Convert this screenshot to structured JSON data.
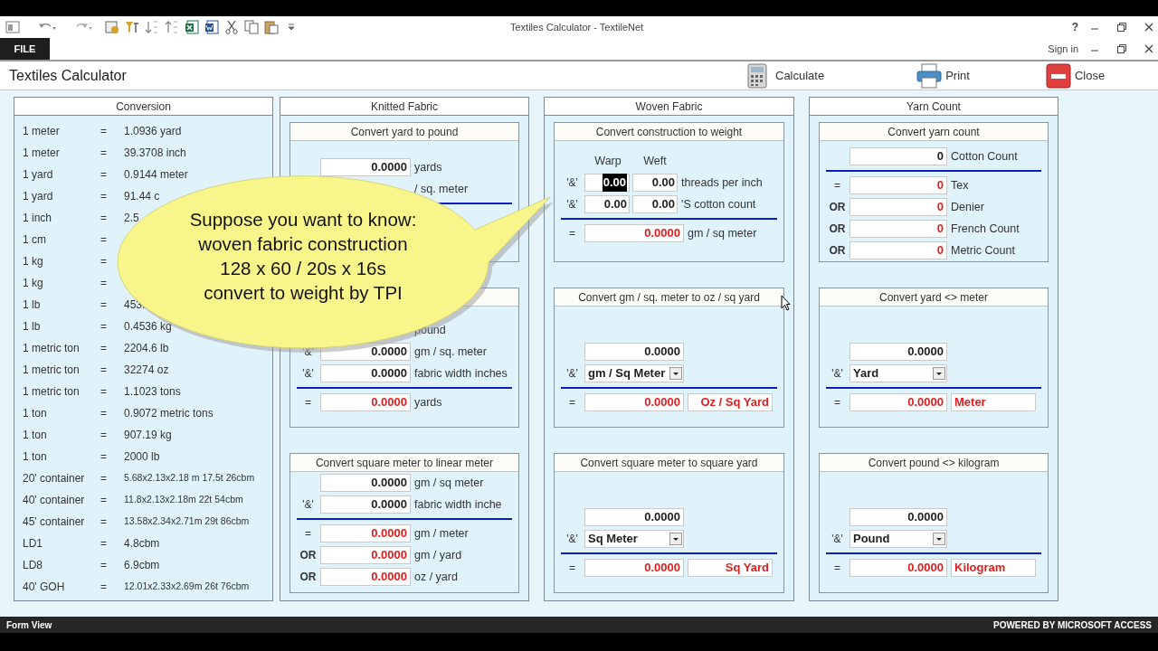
{
  "window": {
    "title": "Textiles Calculator - TextileNet",
    "help": "?",
    "file_tab": "FILE",
    "sign_in": "Sign in"
  },
  "form": {
    "title": "Textiles Calculator",
    "actions": [
      {
        "label": "Calculate",
        "kind": "calculate"
      },
      {
        "label": "Print",
        "kind": "print"
      },
      {
        "label": "Close",
        "kind": "close"
      }
    ]
  },
  "conversion": {
    "title": "Conversion",
    "rows": [
      {
        "unit": "1 meter",
        "eq": "=",
        "value": "1.0936 yard"
      },
      {
        "unit": "1 meter",
        "eq": "=",
        "value": "39.3708 inch"
      },
      {
        "unit": "1 yard",
        "eq": "=",
        "value": "0.9144 meter"
      },
      {
        "unit": "1 yard",
        "eq": "=",
        "value": "91.44 c"
      },
      {
        "unit": "1 inch",
        "eq": "=",
        "value": "2.5"
      },
      {
        "unit": "1 cm",
        "eq": "="
      },
      {
        "unit": "1 kg",
        "eq": "="
      },
      {
        "unit": "1 kg",
        "eq": "="
      },
      {
        "unit": "1 lb",
        "eq": "=",
        "value": "453."
      },
      {
        "unit": "1 lb",
        "eq": "=",
        "value": "0.4536 kg"
      },
      {
        "unit": "1 metric ton",
        "eq": "=",
        "value": "2204.6 lb"
      },
      {
        "unit": "1 metric ton",
        "eq": "=",
        "value": "32274 oz"
      },
      {
        "unit": "1 metric ton",
        "eq": "=",
        "value": "1.1023 tons"
      },
      {
        "unit": "1 ton",
        "eq": "=",
        "value": "0.9072 metric tons"
      },
      {
        "unit": "1 ton",
        "eq": "=",
        "value": "907.19 kg"
      },
      {
        "unit": "1 ton",
        "eq": "=",
        "value": "2000 lb"
      },
      {
        "unit": "20' container",
        "eq": "=",
        "value": "5.68x2.13x2.18 m 17.5t 26cbm"
      },
      {
        "unit": "40' container",
        "eq": "=",
        "value": "11.8x2.13x2.18m 22t 54cbm"
      },
      {
        "unit": "45' container",
        "eq": "=",
        "value": "13.58x2.34x2.71m 29t 86cbm"
      },
      {
        "unit": "LD1",
        "eq": "=",
        "value": "4.8cbm"
      },
      {
        "unit": "LD8",
        "eq": "=",
        "value": "6.9cbm"
      },
      {
        "unit": "40' GOH",
        "eq": "=",
        "value": "12.01x2.33x2.69m 26t 76cbm"
      }
    ]
  },
  "sections": [
    {
      "title": "Knitted Fabric",
      "boxes": [
        {
          "title": "Convert yard to pound",
          "rows": [
            {
              "kind": "field",
              "value": "0.0000",
              "unit": "yards",
              "result": false
            },
            {
              "kind": "field",
              "unit": "/ sq. meter"
            },
            {
              "kind": "rule"
            }
          ]
        },
        {
          "rows": [
            {
              "kind": "field",
              "unit": "pound"
            },
            {
              "kind": "field",
              "prefix": "'&'",
              "value": "0.0000",
              "unit": "gm / sq. meter",
              "result": false
            },
            {
              "kind": "field",
              "prefix": "'&'",
              "value": "0.0000",
              "unit": "fabric width inches",
              "result": false
            },
            {
              "kind": "rule"
            },
            {
              "kind": "field",
              "prefix": "=",
              "value": "0.0000",
              "unit": "yards",
              "result": true
            }
          ]
        },
        {
          "title": "Convert square meter to linear meter",
          "rows": [
            {
              "kind": "field",
              "value": "0.0000",
              "unit": "gm / sq meter",
              "result": false
            },
            {
              "kind": "field",
              "prefix": "'&'",
              "value": "0.0000",
              "unit": "fabric width inche",
              "result": false
            },
            {
              "kind": "rule"
            },
            {
              "kind": "field",
              "prefix": "=",
              "value": "0.0000",
              "unit": "gm / meter",
              "result": true
            },
            {
              "kind": "field",
              "prefix": "OR",
              "value": "0.0000",
              "unit": "gm / yard",
              "result": true
            },
            {
              "kind": "field",
              "prefix": "OR",
              "value": "0.0000",
              "unit": "oz / yard",
              "result": true
            }
          ]
        }
      ]
    },
    {
      "title": "Woven Fabric",
      "boxes": [
        {
          "title": "Convert construction to weight",
          "rows": [
            {
              "kind": "headers",
              "labels": [
                "Warp",
                "Weft"
              ]
            },
            {
              "kind": "pair",
              "prefix": "'&'",
              "cells": [
                {
                  "value": "0.00",
                  "selected": true
                },
                {
                  "value": "0.00",
                  "selected": false
                }
              ],
              "unit": "threads per inch"
            },
            {
              "kind": "pair",
              "prefix": "'&'",
              "cells": [
                {
                  "value": "0.00",
                  "selected": false
                },
                {
                  "value": "0.00",
                  "selected": false
                }
              ],
              "unit": "'S cotton count"
            },
            {
              "kind": "rule"
            },
            {
              "kind": "field",
              "prefix": "=",
              "value": "0.0000",
              "unit": "gm / sq meter",
              "result": true
            }
          ]
        },
        {
          "title": "Convert gm / sq. meter to oz / sq yard",
          "rows": [
            {
              "kind": "field",
              "value": "0.0000",
              "result": false
            },
            {
              "kind": "select",
              "prefix": "'&'",
              "value": "gm / Sq Meter"
            },
            {
              "kind": "rule"
            },
            {
              "kind": "output",
              "prefix": "=",
              "value": "0.0000",
              "unit": "Oz / Sq Yard"
            }
          ]
        },
        {
          "title": "Convert square meter to square yard",
          "rows": [
            {
              "kind": "field",
              "value": "0.0000",
              "result": false
            },
            {
              "kind": "select",
              "prefix": "'&'",
              "value": "Sq Meter"
            },
            {
              "kind": "rule"
            },
            {
              "kind": "output",
              "prefix": "=",
              "value": "0.0000",
              "unit": "Sq Yard"
            }
          ]
        }
      ]
    },
    {
      "title": "Yarn Count",
      "boxes": [
        {
          "title": "Convert yarn count",
          "rows": [
            {
              "kind": "field",
              "value": "0",
              "unit": "Cotton Count",
              "result": false
            },
            {
              "kind": "rule"
            },
            {
              "kind": "field",
              "prefix": "=",
              "value": "0",
              "unit": "Tex",
              "result": true
            },
            {
              "kind": "field",
              "prefix": "OR",
              "value": "0",
              "unit": "Denier",
              "result": true
            },
            {
              "kind": "field",
              "prefix": "OR",
              "value": "0",
              "unit": "French Count",
              "result": true
            },
            {
              "kind": "field",
              "prefix": "OR",
              "value": "0",
              "unit": "Metric Count",
              "result": true
            }
          ]
        },
        {
          "title": "Convert yard <> meter",
          "rows": [
            {
              "kind": "field",
              "value": "0.0000",
              "result": false
            },
            {
              "kind": "select",
              "prefix": "'&'",
              "value": "Yard"
            },
            {
              "kind": "rule"
            },
            {
              "kind": "output",
              "prefix": "=",
              "value": "0.0000",
              "unit": "Meter"
            }
          ]
        },
        {
          "title": "Convert pound <> kilogram",
          "rows": [
            {
              "kind": "field",
              "value": "0.0000",
              "result": false
            },
            {
              "kind": "select",
              "prefix": "'&'",
              "value": "Pound"
            },
            {
              "kind": "rule"
            },
            {
              "kind": "output",
              "prefix": "=",
              "value": "0.0000",
              "unit": "Kilogram"
            }
          ]
        }
      ]
    }
  ],
  "callout": {
    "text": "Suppose you want to know:\nwoven fabric construction\n128 x 60 / 20s x 16s\nconvert to weight by TPI"
  },
  "status_bar": {
    "left": "Form View",
    "right": "POWERED BY MICROSOFT ACCESS"
  }
}
